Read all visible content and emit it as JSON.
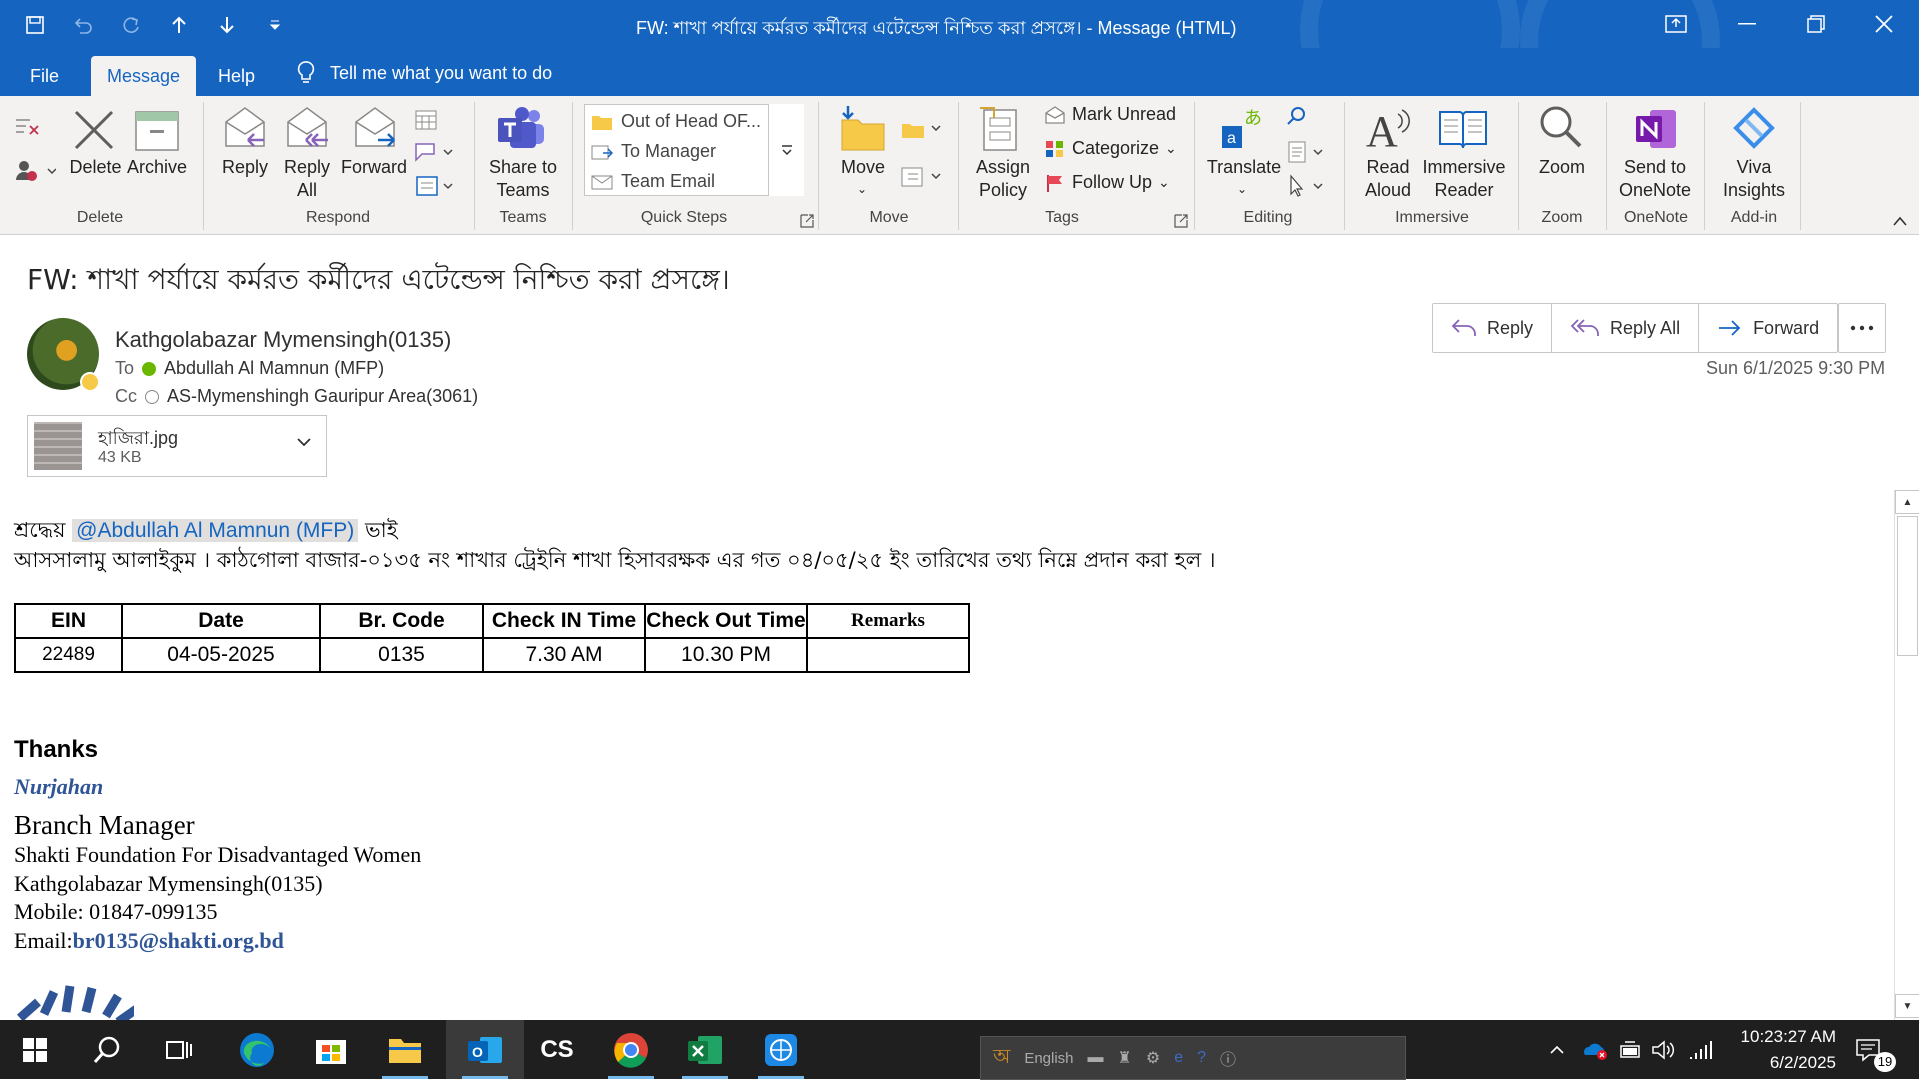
{
  "window": {
    "title": "FW: শাখা পর্যায়ে কর্মরত কর্মীদের এটেন্ডেন্স নিশ্চিত করা প্রসঙ্গে। - Message (HTML)"
  },
  "tabs": [
    {
      "label": "File"
    },
    {
      "label": "Message"
    },
    {
      "label": "Help"
    }
  ],
  "tell_me": "Tell me what you want to do",
  "ribbon": {
    "delete_group": {
      "label": "Delete",
      "delete": "Delete",
      "archive": "Archive"
    },
    "respond_group": {
      "label": "Respond",
      "reply": "Reply",
      "reply_all_1": "Reply",
      "reply_all_2": "All",
      "forward": "Forward"
    },
    "teams_group": {
      "label": "Teams",
      "share_1": "Share to",
      "share_2": "Teams"
    },
    "quick_steps": {
      "label": "Quick Steps",
      "items": [
        "Out of Head OF...",
        "To Manager",
        "Team Email"
      ]
    },
    "move_group": {
      "label": "Move",
      "move": "Move"
    },
    "tags_group": {
      "label": "Tags",
      "assign_1": "Assign",
      "assign_2": "Policy",
      "mark_unread": "Mark Unread",
      "categorize": "Categorize",
      "follow_up": "Follow Up"
    },
    "editing_group": {
      "label": "Editing",
      "translate": "Translate"
    },
    "immersive_group": {
      "label": "Immersive",
      "read_1": "Read",
      "read_2": "Aloud",
      "reader_1": "Immersive",
      "reader_2": "Reader"
    },
    "zoom_group": {
      "label": "Zoom",
      "zoom": "Zoom"
    },
    "onenote_group": {
      "label": "OneNote",
      "send_1": "Send to",
      "send_2": "OneNote"
    },
    "addin_group": {
      "label": "Add-in",
      "viva_1": "Viva",
      "viva_2": "Insights"
    }
  },
  "message": {
    "subject": "FW: শাখা পর্যায়ে কর্মরত কর্মীদের এটেন্ডেন্স নিশ্চিত করা প্রসঙ্গে।",
    "sender": "Kathgolabazar Mymensingh(0135)",
    "to_label": "To",
    "to": "Abdullah Al Mamnun (MFP)",
    "cc_label": "Cc",
    "cc": "AS-Mymenshingh Gauripur Area(3061)",
    "sent": "Sun 6/1/2025 9:30 PM",
    "actions": {
      "reply": "Reply",
      "reply_all": "Reply All",
      "forward": "Forward"
    },
    "attachment": {
      "name": "হাজিরা.jpg",
      "size": "43 KB"
    }
  },
  "body": {
    "greeting_prefix": "শ্রদ্ধেয়",
    "mention": "@Abdullah Al Mamnun (MFP)",
    "greeting_suffix": "ভাই",
    "line2": "আসসালামু আলাইকুম । কাঠগোলা বাজার-০১৩৫ নং শাখার ট্রেইনি শাখা হিসাবরক্ষক এর গত ০৪/০৫/২৫ ইং তারিখের তথ্য নিম্নে প্রদান করা হল ।"
  },
  "attendance_table": {
    "headers": [
      "EIN",
      "Date",
      "Br. Code",
      "Check IN Time",
      "Check Out Time",
      "Remarks"
    ],
    "rows": [
      [
        "22489",
        "04-05-2025",
        "0135",
        "7.30 AM",
        "10.30 PM",
        ""
      ]
    ]
  },
  "signature": {
    "thanks": "Thanks",
    "name": "Nurjahan",
    "title": "Branch Manager",
    "org": "Shakti Foundation For Disadvantaged Women",
    "branch": "Kathgolabazar Mymensingh(0135)",
    "mobile": "Mobile: 01847-099135",
    "email_label": "Email:",
    "email": "br0135@shakti.org.bd"
  },
  "taskbar": {
    "lang": "English",
    "time": "10:23:27 AM",
    "date": "6/2/2025",
    "notifications": "19"
  },
  "colors": {
    "titlebar": "#1565c0",
    "ribbon": "#f3f2f1",
    "link": "#2f5597",
    "taskbar": "#1f1f1f"
  }
}
